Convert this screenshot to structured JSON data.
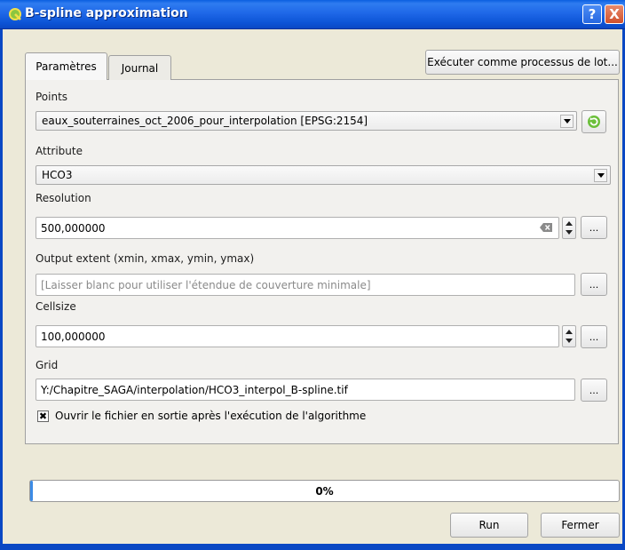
{
  "window": {
    "title": "B-spline approximation",
    "help_glyph": "?",
    "close_glyph": "X"
  },
  "tabs": [
    {
      "label": "Paramètres",
      "active": true
    },
    {
      "label": "Journal",
      "active": false
    }
  ],
  "batch_button": "Exécuter comme processus de lot...",
  "points": {
    "label": "Points",
    "value": "eaux_souterraines_oct_2006_pour_interpolation [EPSG:2154]"
  },
  "attribute": {
    "label": "Attribute",
    "value": "HCO3"
  },
  "resolution": {
    "label": "Resolution",
    "value": "500,000000"
  },
  "output_extent": {
    "label": "Output extent (xmin, xmax, ymin, ymax)",
    "placeholder": "[Laisser blanc pour utiliser l'étendue de couverture minimale]"
  },
  "cellsize": {
    "label": "Cellsize",
    "value": "100,000000"
  },
  "grid": {
    "label": "Grid",
    "value": "Y:/Chapitre_SAGA/interpolation/HCO3_interpol_B-spline.tif"
  },
  "browse_label": "...",
  "open_output": {
    "label": "Ouvrir le fichier en sortie après l'exécution de l'algorithme",
    "checked": true,
    "mark": "✖"
  },
  "progress": {
    "value": 0,
    "text": "0%"
  },
  "buttons": {
    "run": "Run",
    "close": "Fermer"
  },
  "colors": {
    "titlebar": "#0a5fe0",
    "progress_fill": "#3c8be6",
    "close_button": "#d0502c"
  }
}
